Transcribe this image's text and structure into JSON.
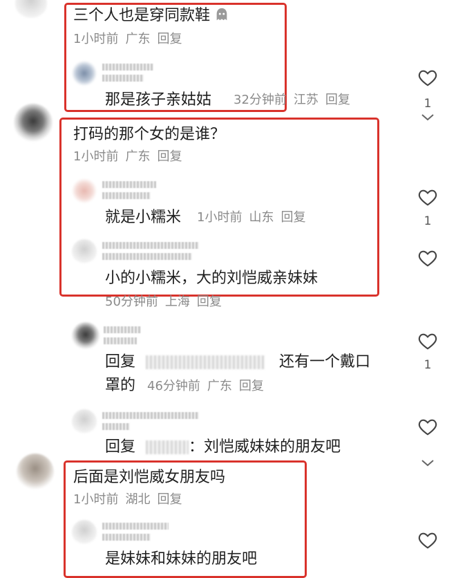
{
  "comments": [
    {
      "text": "三个人也是穿同款鞋",
      "time": "1小时前",
      "location": "广东",
      "reply_label": "回复",
      "reply": {
        "text": "那是孩子亲姑姑",
        "time": "32分钟前",
        "location": "江苏",
        "reply_label": "回复",
        "likes": "1"
      }
    },
    {
      "text": "打码的那个女的是谁？",
      "time": "1小时前",
      "location": "广东",
      "reply_label": "回复",
      "replies": [
        {
          "text": "就是小糯米",
          "time": "1小时前",
          "location": "山东",
          "reply_label": "回复",
          "likes": "1"
        },
        {
          "text": "小的小糯米，大的刘恺威亲妹妹",
          "time": "50分钟前",
          "location": "上海",
          "reply_label": "回复"
        },
        {
          "prefix": "回复",
          "text": "还有一个戴口",
          "text2": "罩的",
          "time": "46分钟前",
          "location": "广东",
          "reply_label": "回复",
          "likes": "1"
        },
        {
          "prefix": "回复",
          "text": "：刘恺威妹妹的朋友吧"
        }
      ]
    },
    {
      "text": "后面是刘恺威女朋友吗",
      "time": "1小时前",
      "location": "湖北",
      "reply_label": "回复",
      "reply": {
        "text": "是妹妹和妹妹的朋友吧"
      }
    }
  ],
  "colors": {
    "highlight": "#d9322b",
    "meta": "#8a8a8a"
  },
  "icons": {
    "like": "heart-outline-icon",
    "expand": "chevron-down-icon",
    "sticker": "ghost-sticker-icon"
  }
}
